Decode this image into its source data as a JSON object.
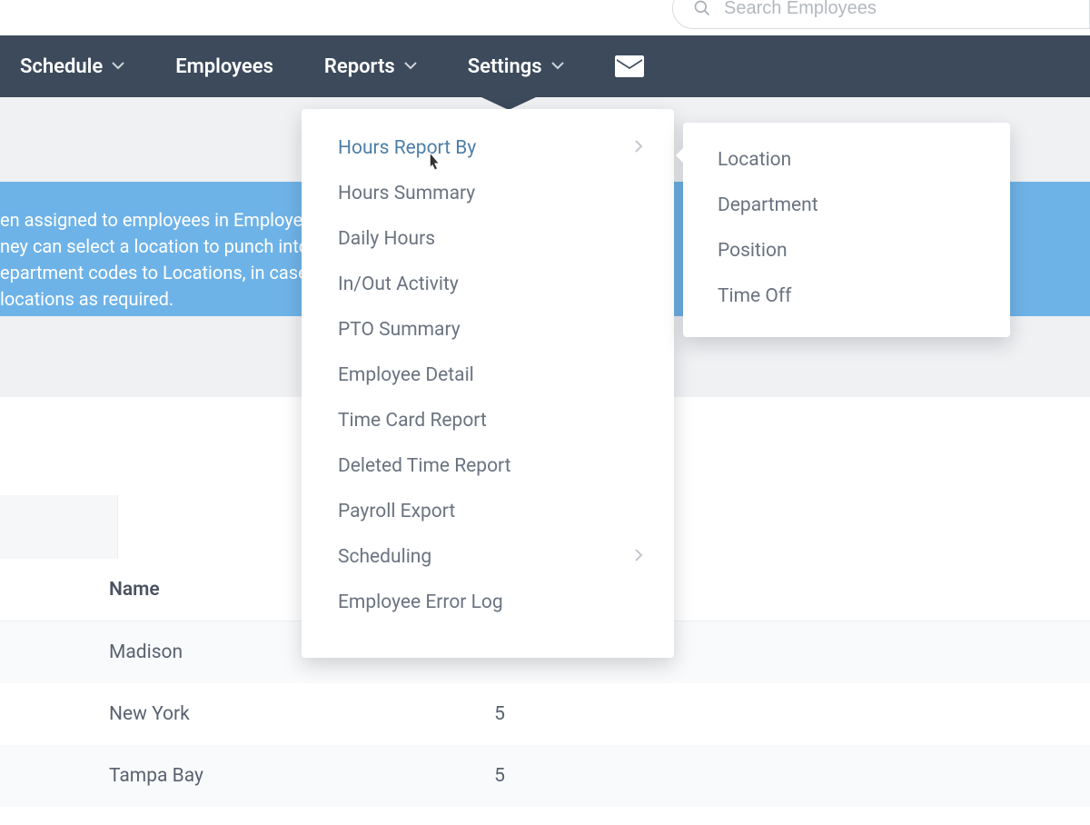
{
  "search": {
    "placeholder": "Search Employees"
  },
  "nav": {
    "schedule": "Schedule",
    "employees": "Employees",
    "reports": "Reports",
    "settings": "Settings"
  },
  "banner": {
    "l1": "en assigned to employees in Employees",
    "l2": "ney can select a location to punch into.",
    "l3": "epartment codes to Locations, in case yo",
    "l4": " locations as required."
  },
  "table": {
    "header_name": "Name",
    "rows": [
      {
        "name": "Madison",
        "value": ""
      },
      {
        "name": "New York",
        "value": "5"
      },
      {
        "name": "Tampa Bay",
        "value": "5"
      }
    ]
  },
  "reports_menu": {
    "hours_report_by": "Hours Report By",
    "hours_summary": "Hours Summary",
    "daily_hours": "Daily Hours",
    "in_out_activity": "In/Out Activity",
    "pto_summary": "PTO Summary",
    "employee_detail": "Employee Detail",
    "time_card_report": "Time Card Report",
    "deleted_time_report": "Deleted Time Report",
    "payroll_export": "Payroll Export",
    "scheduling": "Scheduling",
    "employee_error_log": "Employee Error Log"
  },
  "hours_by_submenu": {
    "location": "Location",
    "department": "Department",
    "position": "Position",
    "time_off": "Time Off"
  }
}
